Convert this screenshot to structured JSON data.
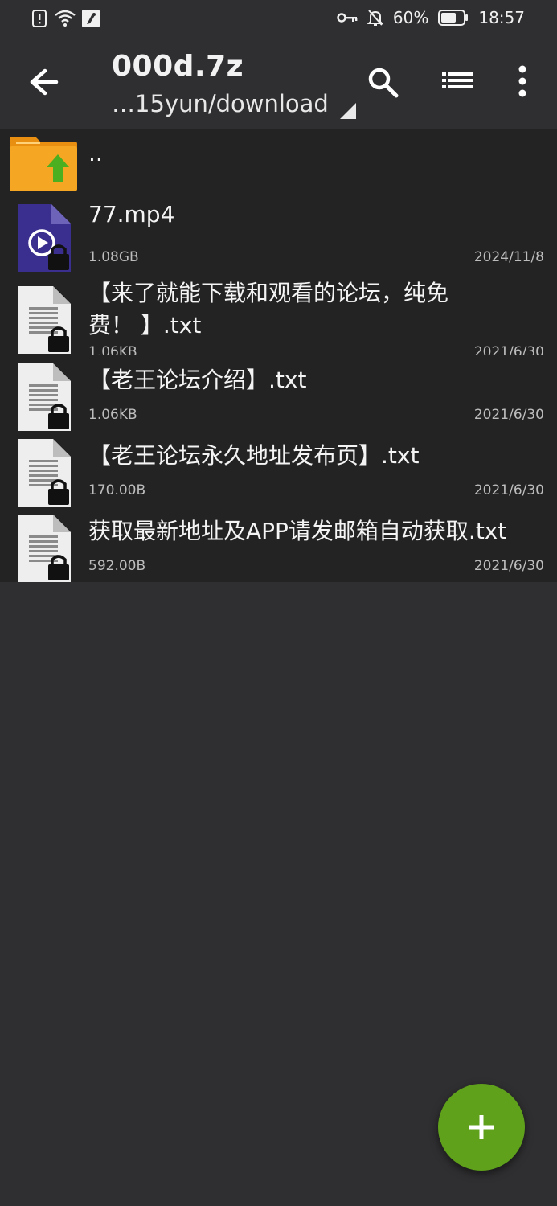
{
  "status_bar": {
    "battery_percent": "60%",
    "time": "18:57",
    "icons": [
      "alert-icon",
      "wifi-icon",
      "app-notification-icon",
      "vpn-key-icon",
      "bell-muted-icon",
      "battery-icon"
    ]
  },
  "app_bar": {
    "title": "000d.7z",
    "path": "…15yun/download"
  },
  "files": [
    {
      "name": "..",
      "type": "parent-folder"
    },
    {
      "name": "77.mp4",
      "size": "1.08GB",
      "date": "2024/11/8",
      "type": "video"
    },
    {
      "name_line1": "【来了就能下载和观看的论坛，纯免",
      "name_line2": "费！ 】.txt",
      "size": "1.06KB",
      "date": "2021/6/30",
      "type": "text"
    },
    {
      "name": "【老王论坛介绍】.txt",
      "size": "1.06KB",
      "date": "2021/6/30",
      "type": "text"
    },
    {
      "name": "【老王论坛永久地址发布页】.txt",
      "size": "170.00B",
      "date": "2021/6/30",
      "type": "text"
    },
    {
      "name": "获取最新地址及APP请发邮箱自动获取.txt",
      "size": "592.00B",
      "date": "2021/6/30",
      "type": "text"
    }
  ],
  "colors": {
    "background": "#2f2f31",
    "list_row": "#232324",
    "fab": "#5fa11b",
    "folder": "#f5a623",
    "video_icon": "#3a2f8f"
  }
}
